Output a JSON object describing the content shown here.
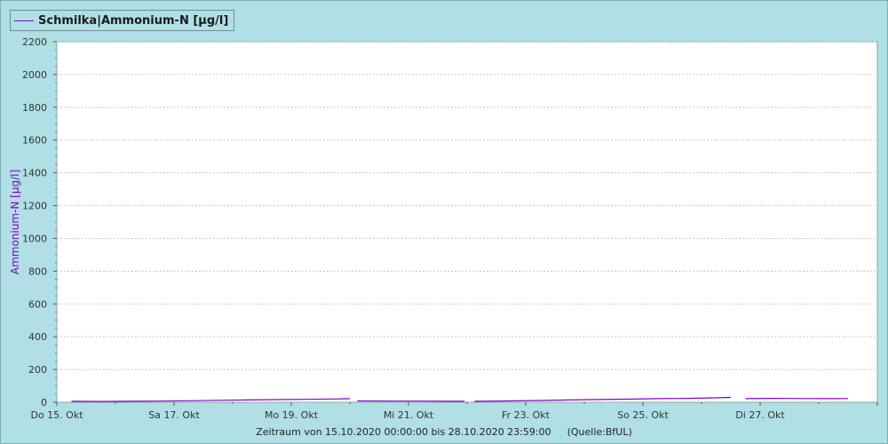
{
  "legend": {
    "label": "Schmilka|Ammonium-N [µg/l]"
  },
  "footer": {
    "period": "Zeitraum von 15.10.2020 00:00:00 bis 28.10.2020 23:59:00",
    "source": "(Quelle:BfUL)"
  },
  "colors": {
    "series": "#8000c0",
    "background": "#b0dfe5",
    "plot": "#ffffff",
    "grid": "#c8c8c8"
  },
  "chart_data": {
    "type": "line",
    "ylabel": "Ammonium-N [µg/l]",
    "ylim": [
      0,
      2200
    ],
    "yticks": [
      0,
      200,
      400,
      600,
      800,
      1000,
      1200,
      1400,
      1600,
      1800,
      2000,
      2200
    ],
    "xlim": [
      "2020-10-15T00:00",
      "2020-10-29T00:00"
    ],
    "xtick_labels": [
      "Do 15. Okt",
      "Sa 17. Okt",
      "Mo 19. Okt",
      "Mi 21. Okt",
      "Fr 23. Okt",
      "So 25. Okt",
      "Di 27. Okt"
    ],
    "grid": true,
    "series": [
      {
        "name": "Schmilka|Ammonium-N [µg/l]",
        "color": "#8000c0",
        "segments": [
          {
            "x": [
              "2020-10-15T06:00",
              "2020-10-15T18:00",
              "2020-10-16T06:00",
              "2020-10-16T18:00",
              "2020-10-17T06:00",
              "2020-10-17T18:00",
              "2020-10-18T06:00",
              "2020-10-18T18:00",
              "2020-10-19T06:00",
              "2020-10-19T18:00",
              "2020-10-20T00:00"
            ],
            "y": [
              6,
              5,
              6,
              7,
              9,
              12,
              14,
              16,
              18,
              20,
              22
            ]
          },
          {
            "x": [
              "2020-10-20T03:00",
              "2020-10-20T18:00",
              "2020-10-21T06:00",
              "2020-10-21T18:00",
              "2020-10-21T23:00"
            ],
            "y": [
              8,
              7,
              7,
              6,
              6
            ]
          },
          {
            "x": [
              "2020-10-22T03:00",
              "2020-10-22T18:00",
              "2020-10-23T06:00",
              "2020-10-23T18:00",
              "2020-10-24T06:00",
              "2020-10-24T18:00",
              "2020-10-25T06:00",
              "2020-10-25T18:00",
              "2020-10-26T06:00",
              "2020-10-26T12:00"
            ],
            "y": [
              6,
              8,
              11,
              14,
              17,
              19,
              22,
              24,
              27,
              30
            ]
          },
          {
            "x": [
              "2020-10-26T18:00",
              "2020-10-27T06:00",
              "2020-10-27T18:00",
              "2020-10-28T06:00",
              "2020-10-28T12:00"
            ],
            "y": [
              22,
              24,
              23,
              22,
              23
            ]
          }
        ]
      }
    ]
  }
}
